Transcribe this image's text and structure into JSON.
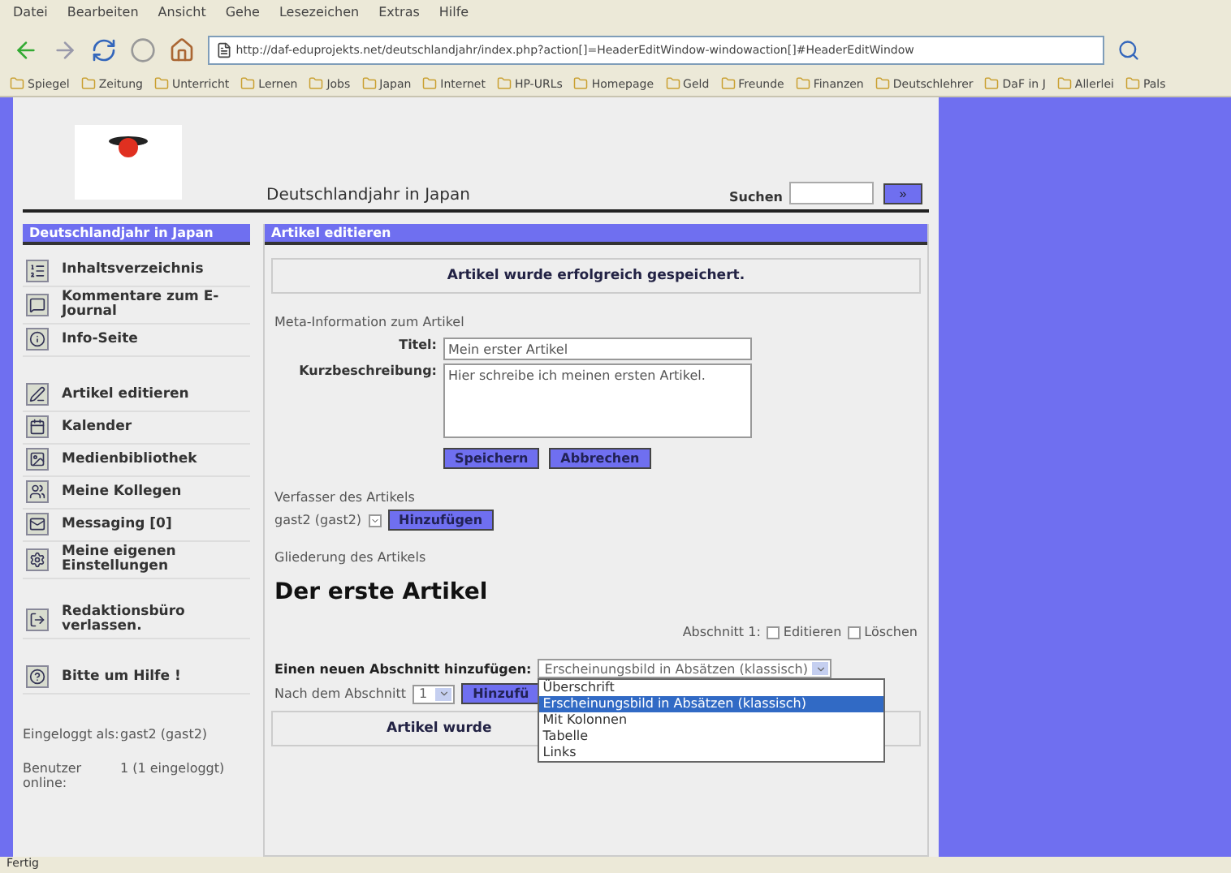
{
  "browser": {
    "menu": [
      "Datei",
      "Bearbeiten",
      "Ansicht",
      "Gehe",
      "Lesezeichen",
      "Extras",
      "Hilfe"
    ],
    "address": "http://daf-eduprojekts.net/deutschlandjahr/index.php?action[]=HeaderEditWindow-windowaction[]#HeaderEditWindow",
    "bookmarks": [
      "Spiegel",
      "Zeitung",
      "Unterricht",
      "Lernen",
      "Jobs",
      "Japan",
      "Internet",
      "HP-URLs",
      "Homepage",
      "Geld",
      "Freunde",
      "Finanzen",
      "Deutschlehrer",
      "DaF in J",
      "Allerlei",
      "Pals"
    ],
    "status": "Fertig"
  },
  "header": {
    "site_title": "Deutschlandjahr in Japan",
    "search_label": "Suchen",
    "search_button": "»"
  },
  "sidebar": {
    "title": "Deutschlandjahr in Japan",
    "sections": [
      {
        "items": [
          {
            "label": "Inhaltsverzeichnis"
          },
          {
            "label": "Kommentare zum E-Journal"
          },
          {
            "label": "Info-Seite"
          }
        ]
      },
      {
        "items": [
          {
            "label": "Artikel editieren"
          },
          {
            "label": "Kalender"
          },
          {
            "label": "Medienbibliothek"
          },
          {
            "label": "Meine Kollegen"
          },
          {
            "label": "Messaging [0]"
          },
          {
            "label": "Meine eigenen Einstellungen"
          }
        ]
      },
      {
        "items": [
          {
            "label": "Redaktionsbüro verlassen."
          }
        ]
      },
      {
        "items": [
          {
            "label": "Bitte um Hilfe !"
          }
        ]
      }
    ],
    "info": [
      {
        "label": "Eingeloggt als:",
        "value": "gast2 (gast2)"
      },
      {
        "label": "Benutzer online:",
        "value": "1 (1 eingeloggt)"
      }
    ]
  },
  "main": {
    "title": "Artikel editieren",
    "message": "Artikel wurde erfolgreich gespeichert.",
    "meta_heading": "Meta-Information zum Artikel",
    "fields": [
      {
        "label": "Titel:",
        "value": "Mein erster Artikel",
        "kind": "input"
      },
      {
        "label": "Kurzbeschreibung:",
        "value": "Hier schreibe ich meinen ersten Artikel.",
        "kind": "textarea"
      }
    ],
    "buttons": [
      "Speichern",
      "Abbrechen"
    ],
    "author_heading": "Verfasser des Artikels",
    "author": "gast2 (gast2)",
    "author_button": "Hinzufügen",
    "outline_heading": "Gliederung des Artikels",
    "article_title": "Der erste Artikel",
    "section_label": "Abschnitt 1:",
    "section_actions": [
      "Editieren",
      "Löschen"
    ],
    "add_label": "Einen neuen Abschnitt hinzufügen:",
    "add_select": "Erscheinungsbild in Absätzen (klassisch)",
    "add_options": [
      {
        "label": "Überschrift",
        "selected": false
      },
      {
        "label": "Erscheinungsbild in Absätzen (klassisch)",
        "selected": true
      },
      {
        "label": "Mit Kolonnen",
        "selected": false
      },
      {
        "label": "Tabelle",
        "selected": false
      },
      {
        "label": "Links",
        "selected": false
      }
    ],
    "after_label": "Nach dem Abschnitt",
    "after_select": "1",
    "add_button": "Hinzufü",
    "bottom_message": "Artikel wurde"
  }
}
